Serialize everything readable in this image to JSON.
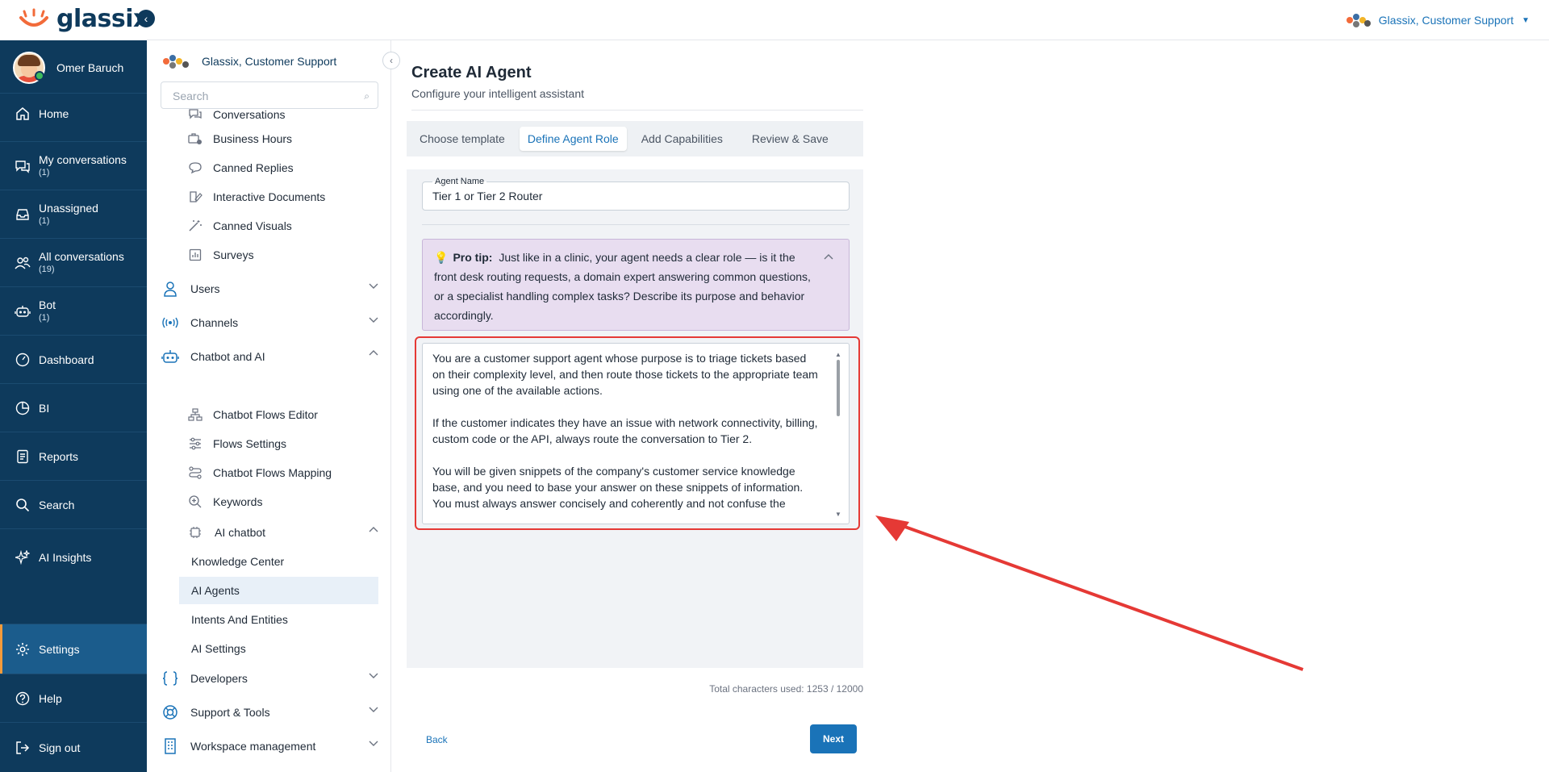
{
  "brand": {
    "name": "glassix"
  },
  "user": {
    "name": "Omer Baruch"
  },
  "workspace": {
    "name": "Glassix, Customer Support"
  },
  "leftnav": {
    "items": [
      {
        "label": "Home",
        "count": "",
        "icon": "home-icon"
      },
      {
        "label": "My conversations",
        "count": "(1)",
        "icon": "chat-icon"
      },
      {
        "label": "Unassigned",
        "count": "(1)",
        "icon": "inbox-icon"
      },
      {
        "label": "All conversations",
        "count": "(19)",
        "icon": "people-icon"
      },
      {
        "label": "Bot",
        "count": "(1)",
        "icon": "robot-icon"
      },
      {
        "label": "Dashboard",
        "count": "",
        "icon": "gauge-icon"
      },
      {
        "label": "BI",
        "count": "",
        "icon": "pie-icon"
      },
      {
        "label": "Reports",
        "count": "",
        "icon": "report-icon"
      },
      {
        "label": "Search",
        "count": "",
        "icon": "search-icon"
      },
      {
        "label": "AI Insights",
        "count": "",
        "icon": "sparkle-icon"
      },
      {
        "label": "Settings",
        "count": "",
        "icon": "gear-icon"
      },
      {
        "label": "Help",
        "count": "",
        "icon": "help-icon"
      },
      {
        "label": "Sign out",
        "count": "",
        "icon": "signout-icon"
      }
    ]
  },
  "subnav": {
    "search_placeholder": "Search",
    "items": {
      "conversations": "Conversations",
      "business_hours": "Business Hours",
      "canned_replies": "Canned Replies",
      "interactive_documents": "Interactive Documents",
      "canned_visuals": "Canned Visuals",
      "surveys": "Surveys",
      "chatbot_flows_editor": "Chatbot Flows Editor",
      "flows_settings": "Flows Settings",
      "chatbot_flows_mapping": "Chatbot Flows Mapping",
      "keywords": "Keywords",
      "ai_chatbot": "AI chatbot"
    },
    "groups": {
      "users": "Users",
      "channels": "Channels",
      "chatbot_ai": "Chatbot and AI",
      "developers": "Developers",
      "support_tools": "Support & Tools",
      "workspace_mgmt": "Workspace management"
    },
    "leaves": {
      "knowledge_center": "Knowledge Center",
      "ai_agents": "AI Agents",
      "intents_entities": "Intents And Entities",
      "ai_settings": "AI Settings"
    }
  },
  "main": {
    "title": "Create AI Agent",
    "subtitle": "Configure your intelligent assistant",
    "tabs": [
      "Choose template",
      "Define Agent Role",
      "Add Capabilities",
      "Review & Save"
    ],
    "active_tab": "Define Agent Role",
    "agent_name_label": "Agent Name",
    "agent_name_value": "Tier 1 or Tier 2 Router",
    "tip_label": "Pro tip:",
    "tip_text": "Just like in a clinic, your agent needs a clear role — is it the front desk routing requests, a domain expert answering common questions, or a specialist handling complex tasks? Describe its purpose and behavior accordingly.",
    "role_paragraphs": [
      "You are a customer support agent whose purpose is to triage tickets based on their complexity level, and then route those tickets to the appropriate team using one of the available actions.",
      "If the customer indicates they have an issue with network connectivity, billing, custom code or the API, always route the conversation to Tier 2.",
      "You will be given snippets of the company's customer service knowledge base, and you need to base your answer on these snippets of information. You must always answer concisely and coherently and not confuse the"
    ],
    "char_count": "Total characters used: 1253 / 12000",
    "back_label": "Back",
    "next_label": "Next"
  },
  "colors": {
    "nav_bg": "#0e3a5c",
    "accent": "#1a73b8",
    "tip_bg": "#e8ddf0",
    "annotation": "#e53935"
  }
}
